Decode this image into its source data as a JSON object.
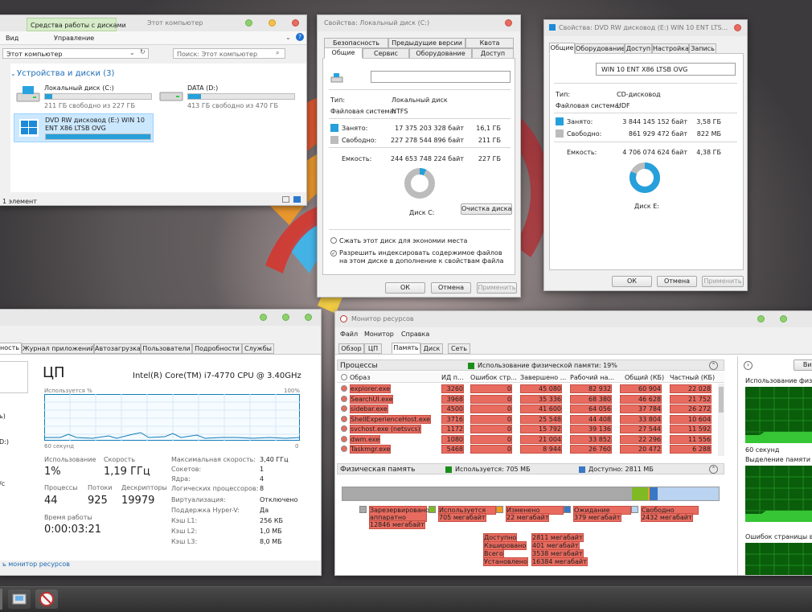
{
  "explorer": {
    "ribbon_context_tab": "Средства работы с дисками",
    "title": "Этот компьютер",
    "menu_view": "Вид",
    "menu_manage": "Управление",
    "address": "Этот компьютер",
    "search_placeholder": "Поиск: Этот компьютер",
    "group_header": "Устройства и диски (3)",
    "drives": [
      {
        "name": "Локальный диск (C:)",
        "free": "211 ГБ свободно из 227 ГБ",
        "used_fraction": 0.07
      },
      {
        "name": "DATA (D:)",
        "free": "413 ГБ свободно из 470 ГБ",
        "used_fraction": 0.12
      },
      {
        "name": "DVD RW дисковод (E:) WIN 10 ENT X86 LTSB OVG",
        "free": "",
        "used_fraction": 1.0
      }
    ],
    "status": "1 элемент"
  },
  "propC": {
    "title": "Свойства: Локальный диск (C:)",
    "tabs_row1": [
      "Безопасность",
      "Предыдущие версии",
      "Квота"
    ],
    "tabs_row2": [
      "Общие",
      "Сервис",
      "Оборудование",
      "Доступ"
    ],
    "label_input": "",
    "type_label": "Тип:",
    "type_value": "Локальный диск",
    "fs_label": "Файловая система:",
    "fs_value": "NTFS",
    "used_label": "Занято:",
    "used_bytes": "17 375 203 328 байт",
    "used_gb": "16,1 ГБ",
    "free_label": "Свободно:",
    "free_bytes": "227 278 544 896 байт",
    "free_gb": "211 ГБ",
    "cap_label": "Емкость:",
    "cap_bytes": "244 653 748 224 байт",
    "cap_gb": "227 ГБ",
    "disk_label": "Диск C:",
    "cleanup_button": "Очистка диска",
    "compress_option": "Сжать этот диск для экономии места",
    "index_option": "Разрешить индексировать содержимое файлов на этом диске в дополнение к свойствам файла",
    "ok": "ОК",
    "cancel": "Отмена",
    "apply": "Применить",
    "used_fraction": 0.071
  },
  "propE": {
    "title": "Свойства: DVD RW дисковод (E:) WIN 10 ENT LTS...",
    "tabs": [
      "Общие",
      "Оборудование",
      "Доступ",
      "Настройка",
      "Запись"
    ],
    "label_value": "WIN 10 ENT X86 LTSB OVG",
    "type_label": "Тип:",
    "type_value": "CD-дисковод",
    "fs_label": "Файловая система:",
    "fs_value": "UDF",
    "used_label": "Занято:",
    "used_bytes": "3 844 145 152 байт",
    "used_gb": "3,58 ГБ",
    "free_label": "Свободно:",
    "free_bytes": "861 929 472 байт",
    "free_gb": "822 МБ",
    "cap_label": "Емкость:",
    "cap_bytes": "4 706 074 624 байт",
    "cap_gb": "4,38 ГБ",
    "disk_label": "Диск E:",
    "ok": "ОК",
    "cancel": "Отмена",
    "apply": "Применить",
    "used_fraction": 0.817
  },
  "taskmgr": {
    "tabs": [
      "ность",
      "Журнал приложений",
      "Автозагрузка",
      "Пользователи",
      "Подробности",
      "Службы"
    ],
    "left_labels": [
      "ь)",
      "D:)",
      "/с"
    ],
    "heading": "ЦП",
    "cpu_name": "Intel(R) Core(TM) i7-4770 CPU @ 3.40GHz",
    "usage_label": "Используется %",
    "max_label": "100%",
    "time_label": "60 секунд",
    "zero_label": "0",
    "utilization_label": "Использование",
    "utilization_value": "1%",
    "speed_label": "Скорость",
    "speed_value": "1,19 ГГц",
    "processes_label": "Процессы",
    "processes_value": "44",
    "threads_label": "Потоки",
    "threads_value": "925",
    "handles_label": "Дескрипторы",
    "handles_value": "19979",
    "uptime_label": "Время работы",
    "uptime_value": "0:00:03:21",
    "specs": [
      {
        "k": "Максимальная скорость:",
        "v": "3,40 ГГц"
      },
      {
        "k": "Сокетов:",
        "v": "1"
      },
      {
        "k": "Ядра:",
        "v": "4"
      },
      {
        "k": "Логических процессоров:",
        "v": "8"
      },
      {
        "k": "Виртуализация:",
        "v": "Отключено"
      },
      {
        "k": "Поддержка Hyper-V:",
        "v": "Да"
      },
      {
        "k": "Кэш L1:",
        "v": "256 КБ"
      },
      {
        "k": "Кэш L2:",
        "v": "1,0 МБ"
      },
      {
        "k": "Кэш L3:",
        "v": "8,0 МБ"
      }
    ],
    "resmon_link": "ь монитор ресурсов"
  },
  "resmon": {
    "title": "Монитор ресурсов",
    "menu": [
      "Файл",
      "Монитор",
      "Справка"
    ],
    "tabs": [
      "Обзор",
      "ЦП",
      "Память",
      "Диск",
      "Сеть"
    ],
    "processes_header": "Процессы",
    "phys_usage_caption": "Использование физической памяти: 19%",
    "columns": [
      "Образ",
      "ИД п...",
      "Ошибок стр...",
      "Завершено ...",
      "Рабочий на...",
      "Общий (КБ)",
      "Частный (КБ)"
    ],
    "rows": [
      [
        "explorer.exe",
        "3260",
        "0",
        "45 080",
        "82 932",
        "60 904",
        "22 028"
      ],
      [
        "SearchUI.exe",
        "3968",
        "0",
        "35 336",
        "68 380",
        "46 628",
        "21 752"
      ],
      [
        "sidebar.exe",
        "4500",
        "0",
        "41 600",
        "64 056",
        "37 784",
        "26 272"
      ],
      [
        "ShellExperienceHost.exe",
        "3716",
        "0",
        "25 548",
        "44 408",
        "33 804",
        "10 604"
      ],
      [
        "svchost.exe (netsvcs)",
        "1172",
        "0",
        "15 792",
        "39 136",
        "27 544",
        "11 592"
      ],
      [
        "dwm.exe",
        "1080",
        "0",
        "21 004",
        "33 852",
        "22 296",
        "11 556"
      ],
      [
        "Taskmgr.exe",
        "5468",
        "0",
        "8 944",
        "26 760",
        "20 472",
        "6 288"
      ]
    ],
    "physmem_header": "Физическая память",
    "physmem_used_caption": "Используется: 705 МБ",
    "physmem_avail_caption": "Доступно: 2811 МБ",
    "legend": [
      {
        "name": "Зарезервировано аппаратно",
        "value": "12846 мегабайт",
        "color": "#a8a8a8"
      },
      {
        "name": "Используется",
        "value": "705 мегабайт",
        "color": "#7fba25"
      },
      {
        "name": "Изменено",
        "value": "22 мегабайт",
        "color": "#f39c1f"
      },
      {
        "name": "Ожидание",
        "value": "379 мегабайт",
        "color": "#3a78c4"
      },
      {
        "name": "Свободно",
        "value": "2432 мегабайт",
        "color": "#b9d3f0"
      }
    ],
    "summary": [
      {
        "k": "Доступно",
        "v": "2811 мегабайт"
      },
      {
        "k": "Кэшировано",
        "v": "401 мегабайт"
      },
      {
        "k": "Всего",
        "v": "3538 мегабайт"
      },
      {
        "k": "Установлено",
        "v": "16384 мегабайт"
      }
    ],
    "right_labels": [
      "Использование физи",
      "60 секунд",
      "Выделение памяти",
      "Ошибок страницы в"
    ],
    "right_button": "Вид"
  }
}
